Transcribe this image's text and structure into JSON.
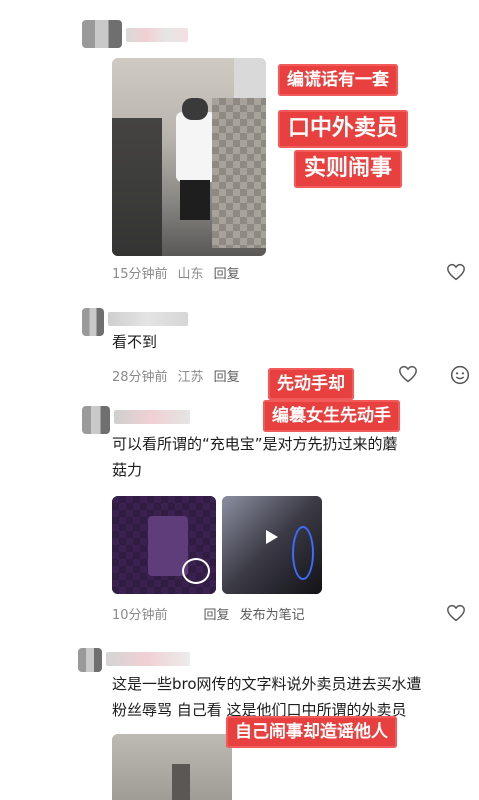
{
  "comments": [
    {
      "time": "15分钟前",
      "location": "山东",
      "reply_label": "回复"
    },
    {
      "text": "看不到",
      "time": "28分钟前",
      "location": "江苏",
      "reply_label": "回复"
    },
    {
      "text_line1": "可以看所谓的“充电宝”是对方先扔过来的蘑",
      "text_line2": "菇力",
      "time": "10分钟前",
      "reply_label": "回复",
      "note_label": "发布为笔记"
    },
    {
      "text_line1": "这是一些bro网传的文字料说外卖员进去买水遭",
      "text_line2": "粉丝辱骂 自己看 这是他们口中所谓的外卖员"
    }
  ],
  "captions": {
    "c1": "编谎话有一套",
    "c2": "口中外卖员",
    "c3": "实则闹事",
    "c4": "先动手却",
    "c5": "编篡女生先动手",
    "c6": "自己闹事却造谣他人"
  },
  "colors": {
    "caption_bg": "#e7403f",
    "meta_text": "#8a8a8a"
  },
  "icons": [
    "heart-icon",
    "emoji-icon",
    "play-icon"
  ]
}
